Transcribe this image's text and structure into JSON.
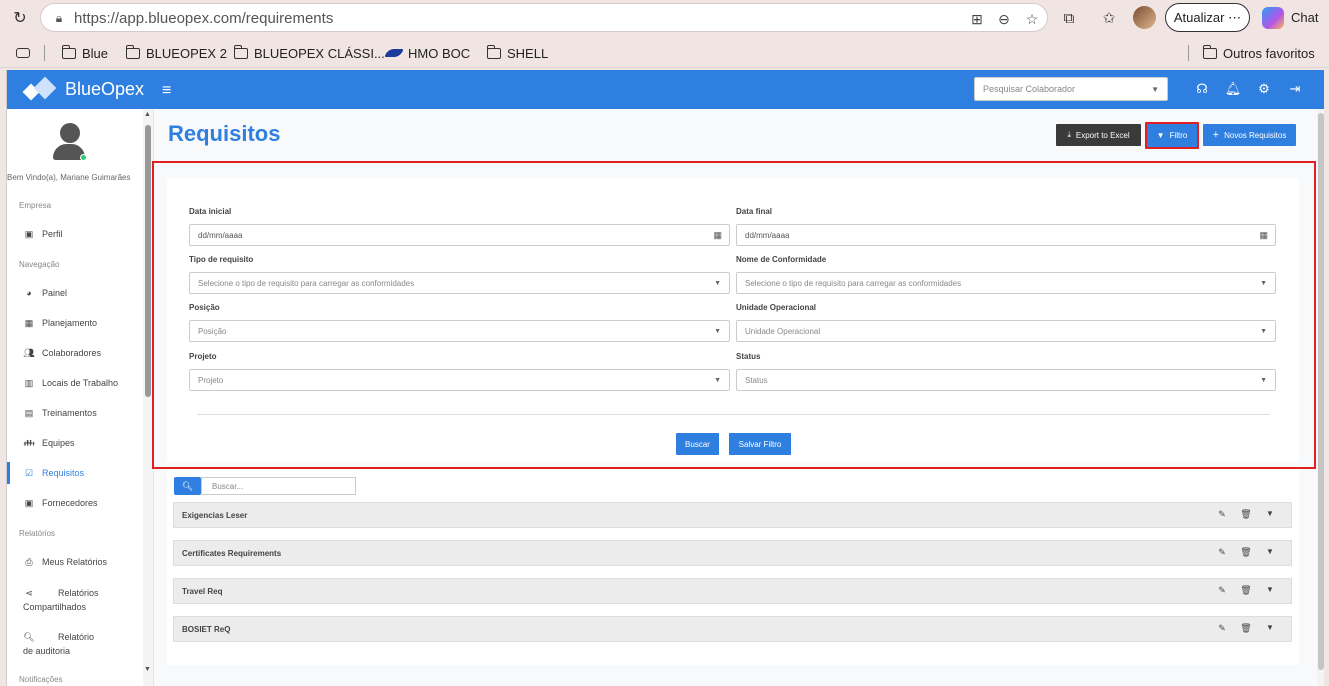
{
  "browser": {
    "url": "https://app.blueopex.com/requirements",
    "update_label": "Atualizar",
    "chat_label": "Chat",
    "bookmarks": [
      "Blue",
      "BLUEOPEX 2",
      "BLUEOPEX CLÁSSI...",
      "HMO BOC",
      "SHELL"
    ],
    "other_favorites": "Outros favoritos"
  },
  "app": {
    "brand": "BlueOpex",
    "search_colab_placeholder": "Pesquisar Colaborador"
  },
  "sidebar": {
    "welcome": "Bem Vindo(a), Mariane Guimarães",
    "section_empresa": "Empresa",
    "perfil": "Perfil",
    "section_navegacao": "Navegação",
    "nav_items": [
      "Painel",
      "Planejamento",
      "Colaboradores",
      "Locais de Trabalho",
      "Treinamentos",
      "Equipes",
      "Requisitos",
      "Fornecedores"
    ],
    "section_relatorios": "Relatórios",
    "report_items": [
      "Meus Relatórios",
      "Relatórios Compartilhados",
      "Relatório de auditoria"
    ],
    "section_notificacoes": "Notificações"
  },
  "page": {
    "title": "Requisitos",
    "export_label": "Export to Excel",
    "filtro_label": "Filtro",
    "novos_label": "Novos Requisitos"
  },
  "filter": {
    "data_inicial_label": "Data inicial",
    "data_inicial_value": "dd/mm/aaaa",
    "data_final_label": "Data final",
    "data_final_value": "dd/mm/aaaa",
    "tipo_label": "Tipo de requisito",
    "tipo_placeholder": "Selecione o tipo de requisito para carregar as conformidades",
    "nome_label": "Nome de Conformidade",
    "nome_placeholder": "Selecione o tipo de requisito para carregar as conformidades",
    "posicao_label": "Posição",
    "posicao_placeholder": "Posição",
    "unidade_label": "Unidade Operacional",
    "unidade_placeholder": "Unidade Operacional",
    "projeto_label": "Projeto",
    "projeto_placeholder": "Projeto",
    "status_label": "Status",
    "status_placeholder": "Status",
    "buscar_label": "Buscar",
    "salvar_label": "Salvar Filtro"
  },
  "list": {
    "search_placeholder": "Buscar...",
    "rows": [
      "Exigencias Leser",
      "Certificates Requirements",
      "Travel Req",
      "BOSIET ReQ"
    ]
  },
  "colors": {
    "primary": "#2f7fe0",
    "highlight": "#e02020",
    "dark_button": "#3a3a3a"
  }
}
